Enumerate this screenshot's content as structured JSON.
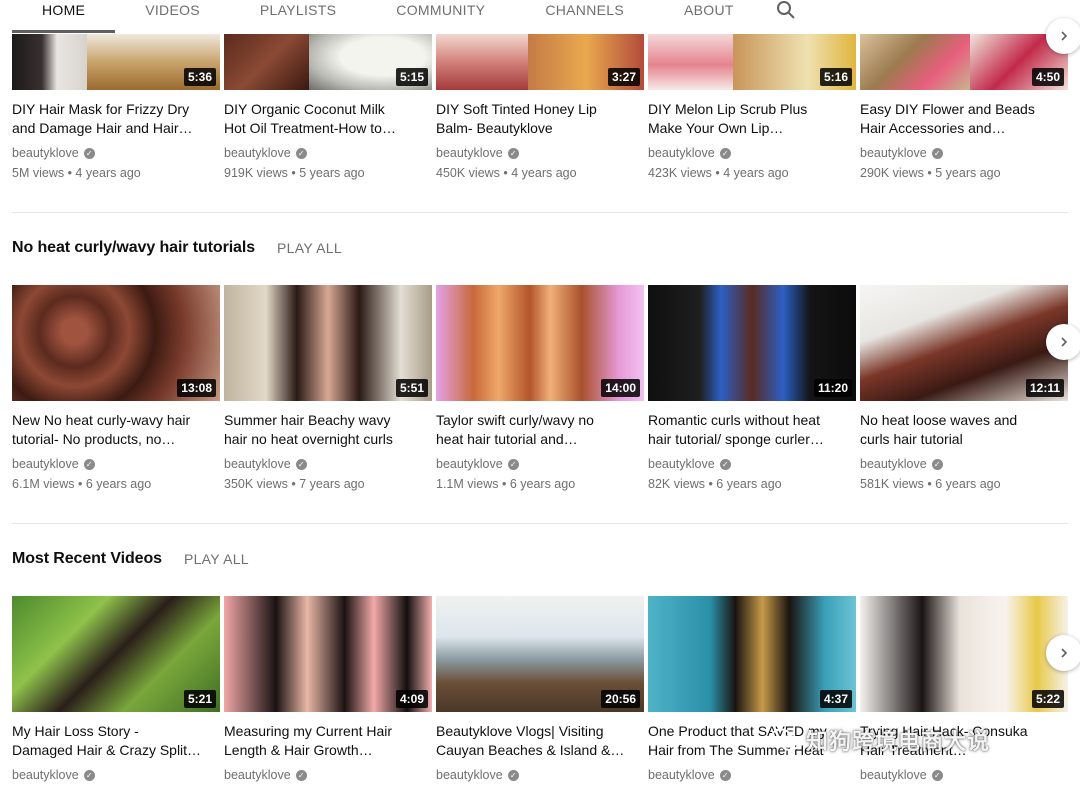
{
  "tabs": {
    "home": "HOME",
    "videos": "VIDEOS",
    "playlists": "PLAYLISTS",
    "community": "COMMUNITY",
    "channels": "CHANNELS",
    "about": "ABOUT"
  },
  "colors": {
    "accent": "#606060",
    "text": "#0f0f0f",
    "secondary_text": "#6f6f6f"
  },
  "shelves": [
    {
      "title": "",
      "play_all": "",
      "videos": [
        {
          "title": "DIY Hair Mask for Frizzy Dry\nand Damage Hair and Hair…",
          "channel": "beautyklove",
          "meta": "5M views • 4 years ago",
          "duration": "5:36"
        },
        {
          "title": "DIY Organic Coconut Milk\nHot Oil Treatment-How to…",
          "channel": "beautyklove",
          "meta": "919K views • 5 years ago",
          "duration": "5:15"
        },
        {
          "title": "DIY Soft Tinted Honey Lip\nBalm- Beautyklove",
          "channel": "beautyklove",
          "meta": "450K views • 4 years ago",
          "duration": "3:27"
        },
        {
          "title": "DIY Melon Lip Scrub Plus\nMake Your Own Lip…",
          "channel": "beautyklove",
          "meta": "423K views • 4 years ago",
          "duration": "5:16"
        },
        {
          "title": "Easy DIY Flower and Beads\nHair Accessories and…",
          "channel": "beautyklove",
          "meta": "290K views • 5 years ago",
          "duration": "4:50"
        }
      ]
    },
    {
      "title": "No heat curly/wavy hair tutorials",
      "play_all": "PLAY ALL",
      "videos": [
        {
          "title": "New No heat curly-wavy hair\ntutorial- No products, no…",
          "channel": "beautyklove",
          "meta": "6.1M views • 6 years ago",
          "duration": "13:08"
        },
        {
          "title": "Summer hair Beachy wavy\nhair no heat overnight curls",
          "channel": "beautyklove",
          "meta": "350K views • 7 years ago",
          "duration": "5:51"
        },
        {
          "title": "Taylor swift curly/wavy no\nheat hair tutorial and…",
          "channel": "beautyklove",
          "meta": "1.1M views • 6 years ago",
          "duration": "14:00"
        },
        {
          "title": "Romantic curls without heat\nhair tutorial/ sponge curler…",
          "channel": "beautyklove",
          "meta": "82K views • 6 years ago",
          "duration": "11:20"
        },
        {
          "title": "No heat loose waves and\ncurls hair tutorial",
          "channel": "beautyklove",
          "meta": "581K views • 6 years ago",
          "duration": "12:11"
        }
      ]
    },
    {
      "title": "Most Recent Videos",
      "play_all": "PLAY ALL",
      "videos": [
        {
          "title": "My Hair Loss Story -\nDamaged Hair & Crazy Split…",
          "channel": "beautyklove",
          "meta": "",
          "duration": "5:21"
        },
        {
          "title": "Measuring my Current Hair\nLength & Hair Growth…",
          "channel": "beautyklove",
          "meta": "",
          "duration": "4:09"
        },
        {
          "title": "Beautyklove Vlogs| Visiting\nCauyan Beaches & Island &…",
          "channel": "beautyklove",
          "meta": "",
          "duration": "20:56"
        },
        {
          "title": "One Product that SAVED my\nHair from The Summer Heat",
          "channel": "beautyklove",
          "meta": "",
          "duration": "4:37"
        },
        {
          "title": "Trying Hair Hack- Consuka\nHair Treatment…",
          "channel": "beautyklove",
          "meta": "",
          "duration": "5:22"
        }
      ]
    }
  ],
  "watermark": "知狗跨境电商大说"
}
